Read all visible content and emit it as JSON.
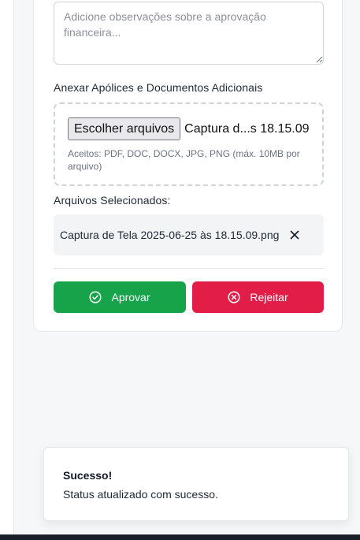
{
  "form": {
    "observations_placeholder": "Adicione observações sobre a aprovação financeira...",
    "observations_value": "",
    "attach_label": "Anexar Apólices e Documentos Adicionais",
    "choose_files_label": "Escolher arquivos",
    "chosen_file_display": "Captura d...s 18.15.09",
    "accepted_hint": "Aceitos: PDF, DOC, DOCX, JPG, PNG (máx. 10MB por arquivo)",
    "selected_files_label": "Arquivos Selecionados:",
    "selected_files": [
      {
        "name": "Captura de Tela 2025-06-25 às 18.15.09.png",
        "remove_icon": "x-icon"
      }
    ]
  },
  "actions": {
    "approve_label": "Aprovar",
    "approve_icon": "check-circle-icon",
    "approve_color": "#16a34a",
    "reject_label": "Rejeitar",
    "reject_icon": "x-circle-icon",
    "reject_color": "#e11d48"
  },
  "toast": {
    "title": "Sucesso!",
    "description": "Status atualizado com sucesso."
  }
}
